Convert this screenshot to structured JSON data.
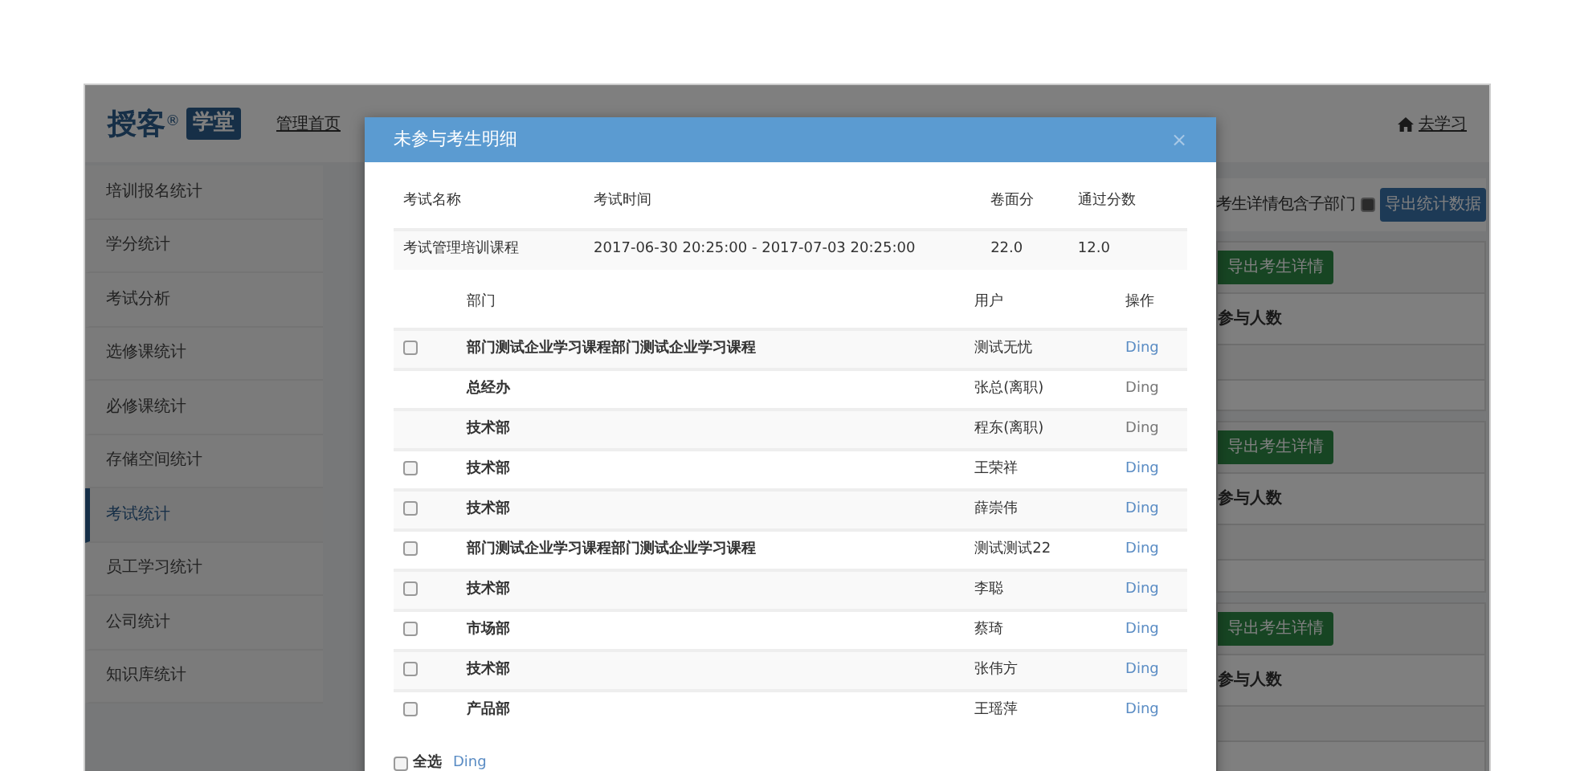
{
  "app": {
    "logo": {
      "name": "授客",
      "mark": "®",
      "badge": "学堂"
    },
    "nav": [
      {
        "label": "管理首页"
      }
    ],
    "home_link": "去学习",
    "sidebar": {
      "items": [
        {
          "label": "培训报名统计",
          "selected": false
        },
        {
          "label": "学分统计",
          "selected": false
        },
        {
          "label": "考试分析",
          "selected": false
        },
        {
          "label": "选修课统计",
          "selected": false
        },
        {
          "label": "必修课统计",
          "selected": false
        },
        {
          "label": "存储空间统计",
          "selected": false
        },
        {
          "label": "考试统计",
          "selected": true
        },
        {
          "label": "员工学习统计",
          "selected": false
        },
        {
          "label": "公司统计",
          "selected": false
        },
        {
          "label": "知识库统计",
          "selected": false
        }
      ]
    },
    "content": {
      "include_sub": {
        "label": "考生详情包含子部门",
        "checked": true
      },
      "export_button": "导出统计数据",
      "panels": [
        {
          "button": "导出考生详情",
          "column": "参与人数"
        },
        {
          "button": "导出考生详情",
          "column": "参与人数"
        },
        {
          "button": "导出考生详情",
          "column": "参与人数"
        }
      ]
    }
  },
  "dialog": {
    "title": "未参与考生明细",
    "close": "×",
    "exam": {
      "columns": [
        "考试名称",
        "考试时间",
        "卷面分",
        "通过分数"
      ],
      "row": [
        "考试管理培训课程",
        "2017-06-30 20:25:00 - 2017-07-03 20:25:00",
        "22.0",
        "12.0"
      ]
    },
    "table": {
      "columns": [
        "部门",
        "用户",
        "操作"
      ],
      "rows": [
        {
          "disabled": false,
          "checked": false,
          "department": "部门测试企业学习课程部门测试企业学习课程",
          "user": "测试无忧",
          "action": "Ding"
        },
        {
          "disabled": true,
          "department": "总经办",
          "user": "张总(离职)",
          "action": "Ding"
        },
        {
          "disabled": true,
          "department": "技术部",
          "user": "程东(离职)",
          "action": "Ding"
        },
        {
          "disabled": false,
          "checked": false,
          "department": "技术部",
          "user": "王荣祥",
          "action": "Ding"
        },
        {
          "disabled": false,
          "checked": false,
          "department": "技术部",
          "user": "薛崇伟",
          "action": "Ding"
        },
        {
          "disabled": false,
          "checked": false,
          "department": "部门测试企业学习课程部门测试企业学习课程",
          "user": "测试测试22",
          "action": "Ding"
        },
        {
          "disabled": false,
          "checked": false,
          "department": "技术部",
          "user": "李聪",
          "action": "Ding"
        },
        {
          "disabled": false,
          "checked": false,
          "department": "市场部",
          "user": "蔡琦",
          "action": "Ding"
        },
        {
          "disabled": false,
          "checked": false,
          "department": "技术部",
          "user": "张伟方",
          "action": "Ding"
        },
        {
          "disabled": false,
          "checked": false,
          "department": "产品部",
          "user": "王瑶萍",
          "action": "Ding"
        }
      ]
    },
    "footer": {
      "select_all": {
        "label": "全选",
        "checked": false
      },
      "action": "Ding"
    }
  }
}
